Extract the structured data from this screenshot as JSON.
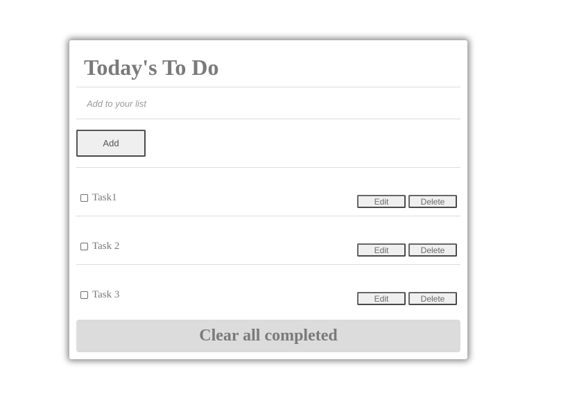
{
  "header": {
    "title": "Today's To Do"
  },
  "new_task": {
    "placeholder": "Add to your list",
    "value": "",
    "add_label": "Add"
  },
  "tasks": [
    {
      "label": "Task1",
      "completed": false,
      "edit_label": "Edit",
      "delete_label": "Delete"
    },
    {
      "label": "Task 2",
      "completed": false,
      "edit_label": "Edit",
      "delete_label": "Delete"
    },
    {
      "label": "Task 3",
      "completed": false,
      "edit_label": "Edit",
      "delete_label": "Delete"
    }
  ],
  "footer": {
    "clear_label": "Clear all completed"
  },
  "colors": {
    "text": "#7a7a7a",
    "button_bg": "#efefef",
    "clear_bg": "#dcdcdc",
    "divider": "#dddddd"
  }
}
